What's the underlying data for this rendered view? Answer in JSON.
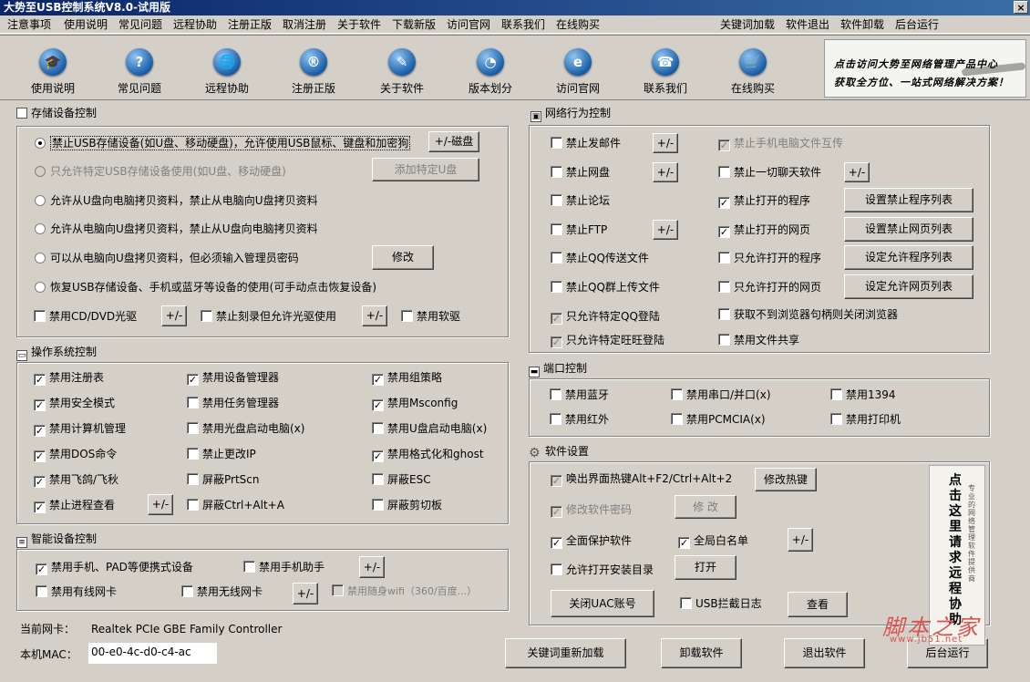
{
  "window": {
    "title": "大势至USB控制系统V8.0-试用版",
    "close_glyph": "×"
  },
  "menu": {
    "left": [
      "注意事项",
      "使用说明",
      "常见问题",
      "远程协助",
      "注册正版",
      "取消注册",
      "关于软件",
      "下载新版",
      "访问官网",
      "联系我们",
      "在线购买"
    ],
    "right": [
      "关键词加载",
      "软件退出",
      "软件卸载",
      "后台运行"
    ]
  },
  "toolbar": [
    {
      "label": "使用说明",
      "icon": "graduation-cap-icon",
      "glyph": "🎓"
    },
    {
      "label": "常见问题",
      "icon": "question-icon",
      "glyph": "?"
    },
    {
      "label": "远程协助",
      "icon": "globe-icon",
      "glyph": "🌐"
    },
    {
      "label": "注册正版",
      "icon": "registered-icon",
      "glyph": "®"
    },
    {
      "label": "关于软件",
      "icon": "document-icon",
      "glyph": "✎"
    },
    {
      "label": "版本划分",
      "icon": "pie-chart-icon",
      "glyph": "◔"
    },
    {
      "label": "访问官网",
      "icon": "ie-icon",
      "glyph": "e"
    },
    {
      "label": "联系我们",
      "icon": "phone-icon",
      "glyph": "☎"
    },
    {
      "label": "在线购买",
      "icon": "cart-icon",
      "glyph": "🛒"
    }
  ],
  "banner": {
    "line1": "点击访问大势至网络管理产品中心",
    "line2": "获取全方位、一站式网络解决方案！"
  },
  "storage": {
    "title": "存储设备控制",
    "options": [
      {
        "label": "禁止USB存储设备(如U盘、移动硬盘)，允许使用USB鼠标、键盘和加密狗",
        "selected": true,
        "disabled": false
      },
      {
        "label": "只允许特定USB存储设备使用(如U盘、移动硬盘)",
        "selected": false,
        "disabled": true
      },
      {
        "label": "允许从U盘向电脑拷贝资料，禁止从电脑向U盘拷贝资料",
        "selected": false,
        "disabled": false
      },
      {
        "label": "允许从电脑向U盘拷贝资料，禁止从U盘向电脑拷贝资料",
        "selected": false,
        "disabled": false
      },
      {
        "label": "可以从电脑向U盘拷贝资料，但必须输入管理员密码",
        "selected": false,
        "disabled": false
      },
      {
        "label": "恢复USB存储设备、手机或蓝牙等设备的使用(可手动点击恢复设备)",
        "selected": false,
        "disabled": false
      }
    ],
    "btn_plus_disk": "+/-磁盘",
    "btn_add_udisk": "添加特定U盘",
    "btn_modify": "修改",
    "cd_dvd": "禁用CD/DVD光驱",
    "burn": "禁止刻录但允许光驱使用",
    "floppy": "禁用软驱",
    "pm": "+/-"
  },
  "os": {
    "title": "操作系统控制",
    "items": [
      {
        "label": "禁用注册表",
        "checked": true
      },
      {
        "label": "禁用设备管理器",
        "checked": true
      },
      {
        "label": "禁用组策略",
        "checked": true
      },
      {
        "label": "禁用安全模式",
        "checked": true
      },
      {
        "label": "禁用任务管理器",
        "checked": false
      },
      {
        "label": "禁用Msconfig",
        "checked": true
      },
      {
        "label": "禁用计算机管理",
        "checked": true
      },
      {
        "label": "禁用光盘启动电脑(x)",
        "checked": false
      },
      {
        "label": "禁用U盘启动电脑(x)",
        "checked": false
      },
      {
        "label": "禁用DOS命令",
        "checked": true
      },
      {
        "label": "禁止更改IP",
        "checked": false
      },
      {
        "label": "禁用格式化和ghost",
        "checked": true
      },
      {
        "label": "禁用飞鸽/飞秋",
        "checked": true
      },
      {
        "label": "屏蔽PrtScn",
        "checked": false
      },
      {
        "label": "屏蔽ESC",
        "checked": false
      },
      {
        "label": "禁止进程查看",
        "checked": true
      },
      {
        "label": "屏蔽Ctrl+Alt+A",
        "checked": false
      },
      {
        "label": "屏蔽剪切板",
        "checked": false
      }
    ],
    "pm": "+/-"
  },
  "smart": {
    "title": "智能设备控制",
    "mobile": "禁用手机、PAD等便携式设备",
    "helper": "禁用手机助手",
    "wired": "禁用有线网卡",
    "wireless": "禁用无线网卡",
    "wifi": "禁用随身wifi（360/百度...）",
    "pm": "+/-"
  },
  "footer": {
    "nic_label": "当前网卡：",
    "nic_value": "Realtek PCIe GBE Family Controller",
    "mac_label": "本机MAC：",
    "mac_value": "00-e0-4c-d0-c4-ac",
    "btn_reload": "关键词重新加载",
    "btn_uninstall": "卸载软件",
    "btn_exit": "退出软件",
    "btn_background": "后台运行"
  },
  "network": {
    "title": "网络行为控制",
    "left": [
      {
        "label": "禁止发邮件",
        "checked": false,
        "disabled": false
      },
      {
        "label": "禁止网盘",
        "checked": false,
        "disabled": false
      },
      {
        "label": "禁止论坛",
        "checked": false,
        "disabled": false
      },
      {
        "label": "禁止FTP",
        "checked": false,
        "disabled": false
      },
      {
        "label": "禁止QQ传送文件",
        "checked": false,
        "disabled": false
      },
      {
        "label": "禁止QQ群上传文件",
        "checked": false,
        "disabled": false
      },
      {
        "label": "只允许特定QQ登陆",
        "checked": true,
        "disabled": true
      },
      {
        "label": "只允许特定旺旺登陆",
        "checked": true,
        "disabled": true
      }
    ],
    "right": [
      {
        "label": "禁止手机电脑文件互传",
        "checked": true,
        "disabled": true
      },
      {
        "label": "禁止一切聊天软件",
        "checked": false,
        "disabled": false
      },
      {
        "label": "禁止打开的程序",
        "checked": true,
        "disabled": false
      },
      {
        "label": "禁止打开的网页",
        "checked": true,
        "disabled": false
      },
      {
        "label": "只允许打开的程序",
        "checked": false,
        "disabled": false
      },
      {
        "label": "只允许打开的网页",
        "checked": false,
        "disabled": false
      },
      {
        "label": "获取不到浏览器句柄则关闭浏览器",
        "checked": false,
        "disabled": false
      },
      {
        "label": "禁用文件共享",
        "checked": false,
        "disabled": false
      }
    ],
    "buttons": [
      "设置禁止程序列表",
      "设置禁止网页列表",
      "设定允许程序列表",
      "设定允许网页列表"
    ],
    "pm": "+/-"
  },
  "port": {
    "title": "端口控制",
    "items": [
      "禁用蓝牙",
      "禁用串口/并口(x)",
      "禁用1394",
      "禁用红外",
      "禁用PCMCIA(x)",
      "禁用打印机"
    ]
  },
  "software": {
    "title": "软件设置",
    "hotkey": "唤出界面热键Alt+F2/Ctrl+Alt+2",
    "btn_hotkey": "修改热键",
    "password": "修改软件密码",
    "btn_password": "修 改",
    "protect": "全面保护软件",
    "whitelist": "全局白名单",
    "pm": "+/-",
    "allow_dir": "允许打开安装目录",
    "btn_open": "打开",
    "btn_uac": "关闭UAC账号",
    "usb_log": "USB拦截日志",
    "btn_view": "查看"
  },
  "side_image": {
    "text": "点击这里请求远程协助",
    "small": "专业的网络管理软件提供商"
  },
  "watermark": {
    "cn": "脚本之家",
    "url": "www.jb51.net"
  },
  "check_glyph": "✓"
}
